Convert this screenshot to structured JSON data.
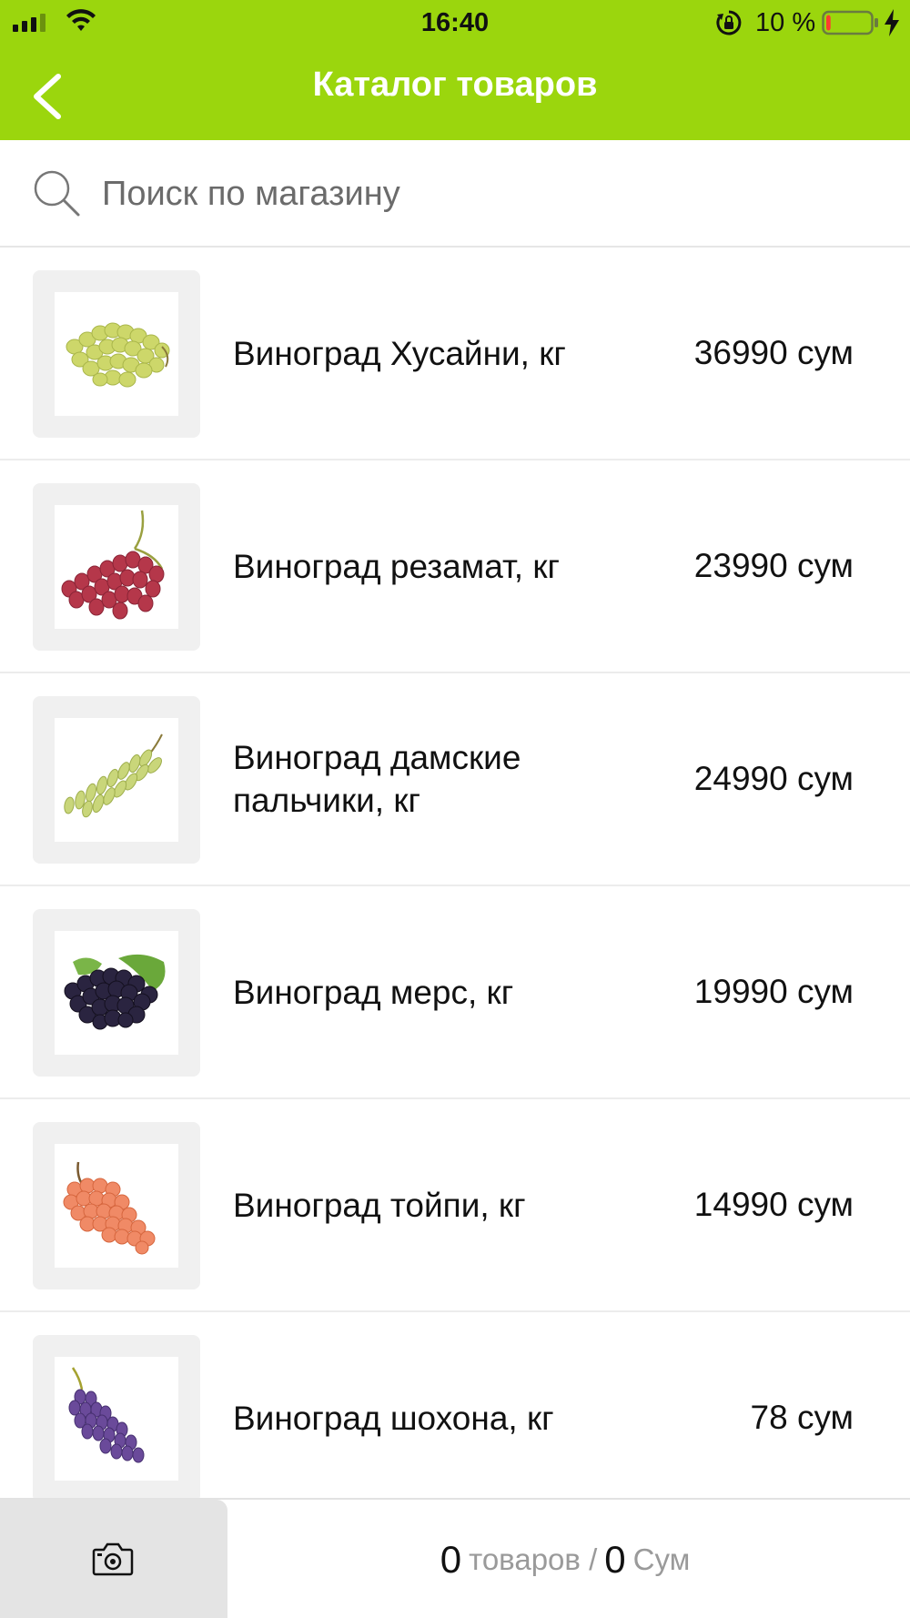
{
  "status_bar": {
    "time": "16:40",
    "battery_percent": "10 %",
    "battery_level": 0.1,
    "icons": [
      "signal-icon",
      "wifi-icon",
      "rotation-lock-icon",
      "battery-icon",
      "charging-bolt-icon"
    ]
  },
  "header": {
    "title": "Каталог товаров",
    "back_icon": "chevron-left-icon"
  },
  "search": {
    "placeholder": "Поиск по магазину",
    "value": "",
    "icon": "search-icon"
  },
  "products": [
    {
      "name": "Виноград Хусайни, кг",
      "price": "36990 сум",
      "image": "green-grapes",
      "color": "#cfd96a"
    },
    {
      "name": "Виноград резамат, кг",
      "price": "23990 сум",
      "image": "red-grapes",
      "color": "#b5374a"
    },
    {
      "name": "Виноград дамские пальчики, кг",
      "price": "24990 сум",
      "image": "long-green-grapes",
      "color": "#c9d67a"
    },
    {
      "name": "Виноград мерс, кг",
      "price": "19990 сум",
      "image": "dark-grapes",
      "color": "#2a2440"
    },
    {
      "name": "Виноград тойпи, кг",
      "price": "14990 сум",
      "image": "pink-grapes",
      "color": "#f08a66"
    },
    {
      "name": "Виноград шохона, кг",
      "price": "78 сум",
      "image": "purple-grapes",
      "color": "#6a4a9a"
    }
  ],
  "cart": {
    "items_count": "0",
    "items_label": "товаров /",
    "sum_count": "0",
    "sum_label": "Сум",
    "camera_icon": "camera-icon"
  },
  "colors": {
    "accent": "#9bd60d",
    "header_text": "#ffffff",
    "muted_text": "#9a9a9a"
  }
}
